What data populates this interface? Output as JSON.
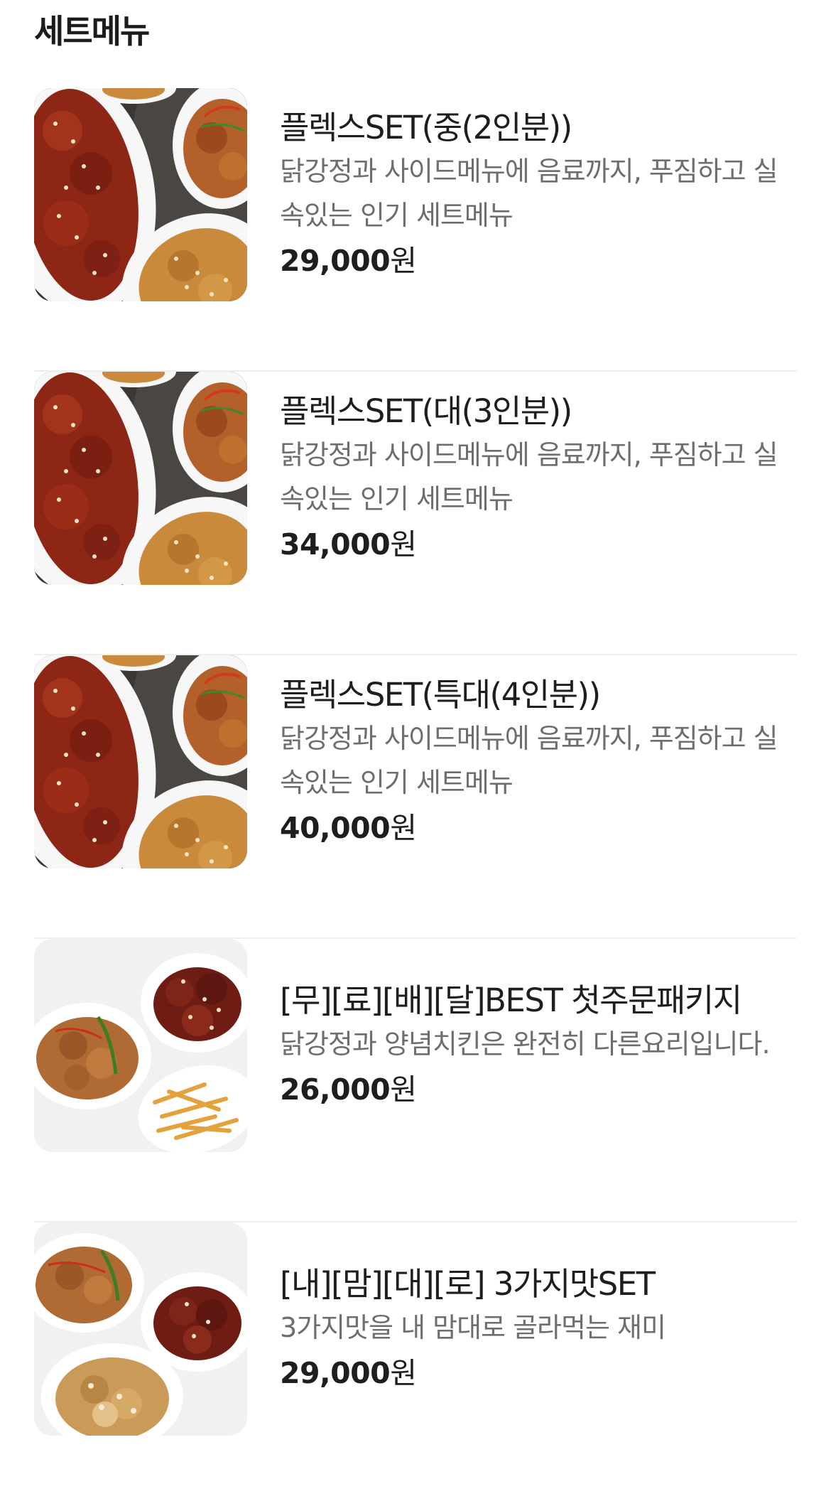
{
  "section": {
    "title": "세트메뉴"
  },
  "items": [
    {
      "name": "플렉스SET(중(2인분))",
      "description": "닭강정과 사이드메뉴에 음료까지, 푸짐하고 실속있는 인기 세트메뉴",
      "price": "29,000",
      "price_unit": "원",
      "image_icon": "sweet-chicken-platter-icon"
    },
    {
      "name": "플렉스SET(대(3인분))",
      "description": "닭강정과 사이드메뉴에 음료까지, 푸짐하고 실속있는 인기 세트메뉴",
      "price": "34,000",
      "price_unit": "원",
      "image_icon": "sweet-chicken-platter-icon"
    },
    {
      "name": "플렉스SET(특대(4인분))",
      "description": "닭강정과 사이드메뉴에 음료까지, 푸짐하고 실속있는 인기 세트메뉴",
      "price": "40,000",
      "price_unit": "원",
      "image_icon": "sweet-chicken-platter-icon"
    },
    {
      "name": "[무][료][배][달]BEST 첫주문패키지",
      "description": "닭강정과 양념치킨은 완전히 다른요리입니다.",
      "price": "26,000",
      "price_unit": "원",
      "image_icon": "chicken-and-fries-icon"
    },
    {
      "name": "[내][맘][대][로] 3가지맛SET",
      "description": "3가지맛을 내 맘대로 골라먹는 재미",
      "price": "29,000",
      "price_unit": "원",
      "image_icon": "three-flavor-chicken-icon"
    }
  ],
  "colors": {
    "text_primary": "#1e1e1e",
    "text_secondary": "#6e6e6e",
    "divider": "#eeeeee",
    "sauce_red": "#8e2616",
    "fried_gold": "#c98a3c"
  }
}
